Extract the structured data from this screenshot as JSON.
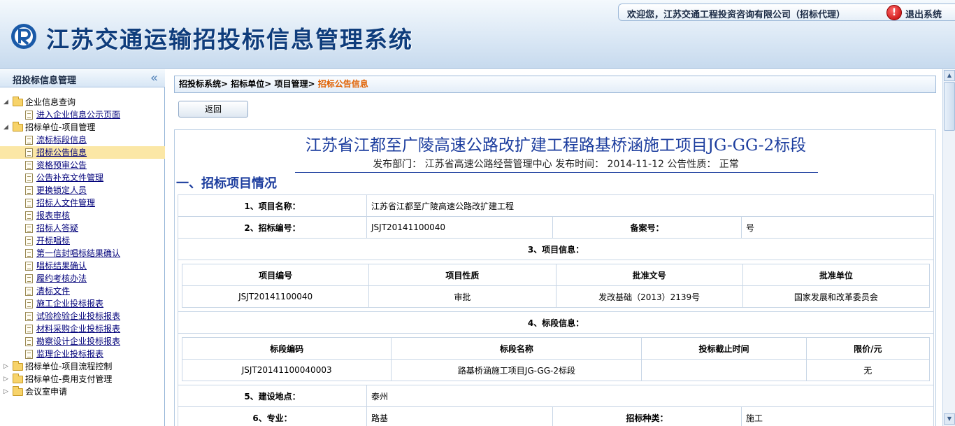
{
  "header": {
    "app_title": "江苏交通运输招投标信息管理系统",
    "welcome": "欢迎您，江苏交通工程投资咨询有限公司（招标代理）",
    "logout": "退出系统",
    "logout_icon_glyph": "!"
  },
  "sidebar": {
    "title": "招投标信息管理",
    "collapse_icon": "«",
    "groups": [
      {
        "label": "企业信息查询",
        "items": [
          {
            "label": "进入企业信息公示页面"
          }
        ]
      },
      {
        "label": "招标单位-项目管理",
        "items": [
          {
            "label": "流标标段信息"
          },
          {
            "label": "招标公告信息"
          },
          {
            "label": "资格预审公告"
          },
          {
            "label": "公告补充文件管理"
          },
          {
            "label": "更换锁定人员"
          },
          {
            "label": "招标人文件管理"
          },
          {
            "label": "报表审核"
          },
          {
            "label": "招标人答疑"
          },
          {
            "label": "开标唱标"
          },
          {
            "label": "第一信封唱标结果确认"
          },
          {
            "label": "唱标结果确认"
          },
          {
            "label": "履约考核办法"
          },
          {
            "label": "清标文件"
          },
          {
            "label": "施工企业投标报表"
          },
          {
            "label": "试验检验企业投标报表"
          },
          {
            "label": "材料采购企业投标报表"
          },
          {
            "label": "勘察设计企业投标报表"
          },
          {
            "label": "监理企业投标报表"
          }
        ]
      },
      {
        "label": "招标单位-项目流程控制"
      },
      {
        "label": "招标单位-费用支付管理"
      },
      {
        "label": "会议室申请"
      }
    ]
  },
  "breadcrumb": {
    "path": "招投标系统> 招标单位> 项目管理> ",
    "current": "招标公告信息"
  },
  "back_button": "返回",
  "notice": {
    "title": "江苏省江都至广陵高速公路改扩建工程路基桥涵施工项目JG-GG-2标段",
    "meta": "发布部门： 江苏省高速公路经营管理中心 发布时间： 2014-11-12 公告性质： 正常",
    "section_1": "一、招标项目情况",
    "rows": {
      "project_name_label": "1、项目名称：",
      "project_name": "江苏省江都至广陵高速公路改扩建工程",
      "tender_no_label": "2、招标编号：",
      "tender_no": "JSJT20141100040",
      "record_no_label": "备案号：",
      "record_no": "号",
      "project_info_label": "3、项目信息：",
      "project_info_headers": [
        "项目编号",
        "项目性质",
        "批准文号",
        "批准单位"
      ],
      "project_info_row": [
        "JSJT20141100040",
        "审批",
        "发改基础（2013）2139号",
        "国家发展和改革委员会"
      ],
      "section_info_label": "4、标段信息：",
      "section_headers": [
        "标段编码",
        "标段名称",
        "投标截止时间",
        "限价/元"
      ],
      "section_row": [
        "JSJT20141100040003",
        "路基桥涵施工项目JG-GG-2标段",
        "",
        "无"
      ],
      "location_label": "5、建设地点：",
      "location": "泰州",
      "specialty_label": "6、专业：",
      "specialty": "路基",
      "tender_type_label": "招标种类：",
      "tender_type": "施工"
    }
  },
  "scrollbar": {
    "up": "▲",
    "down": "▼"
  }
}
